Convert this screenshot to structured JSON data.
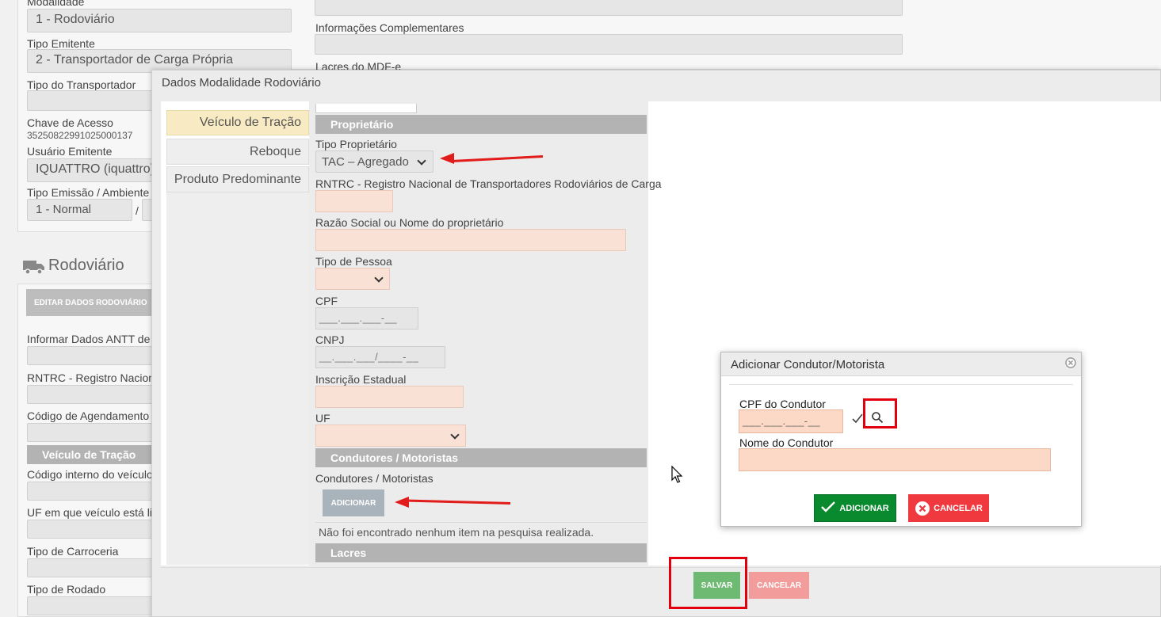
{
  "background": {
    "modalidade_label": "Modalidade",
    "modalidade_value": "1 - Rodoviário",
    "tipo_emitente_label": "Tipo Emitente",
    "tipo_emitente_value": "2 - Transportador de Carga Própria",
    "tipo_transportador_label": "Tipo do Transportador",
    "chave_label": "Chave de Acesso",
    "chave_value": "35250822991025000137",
    "usuario_label": "Usuário Emitente",
    "usuario_value": "IQUATTRO (iquattro)",
    "tipo_emissao_label": "Tipo Emissão / Ambiente",
    "tipo_emissao_value": "1 - Normal",
    "tipo_emissao_sep": "/",
    "info_compl_label": "Informações Complementares",
    "lacres_mdfe_label": "Lacres do MDF-e",
    "rodoviario_title": "Rodoviário",
    "editar_button": "EDITAR DADOS RODOVIÁRIO",
    "informar_antt_label": "Informar Dados ANTT de",
    "rntrc_label": "RNTRC - Registro Naciona",
    "codigo_agendamento_label": "Código de Agendamento n",
    "veiculo_tracao_section": "Veículo de Tração",
    "codigo_interno_label": "Código interno do veículo",
    "uf_licenciado_label": "UF em que veículo está lic",
    "tipo_carroceria_label": "Tipo de Carroceria",
    "tipo_rodado_label": "Tipo de Rodado"
  },
  "modal": {
    "title": "Dados Modalidade Rodoviário",
    "tabs": [
      {
        "label": "Veículo de Tração"
      },
      {
        "label": "Reboque"
      },
      {
        "label": "Produto Predominante"
      }
    ],
    "proprietario_section": "Proprietário",
    "tipo_proprietario_label": "Tipo Proprietário",
    "tipo_proprietario_value": "TAC – Agregado",
    "rntrc_label": "RNTRC - Registro Nacional de Transportadores Rodoviários de Carga",
    "razao_label": "Razão Social ou Nome do proprietário",
    "tipo_pessoa_label": "Tipo de Pessoa",
    "cpf_label": "CPF",
    "cpf_mask": "___.___.___-__",
    "cnpj_label": "CNPJ",
    "cnpj_mask": "__.___.___/____-__",
    "ie_label": "Inscrição Estadual",
    "uf_label": "UF",
    "condutores_section": "Condutores / Motoristas",
    "condutores_label": "Condutores / Motoristas",
    "adicionar_button": "ADICIONAR",
    "empty_message": "Não foi encontrado nenhum item na pesquisa realizada.",
    "lacres_section": "Lacres",
    "salvar_button": "SALVAR",
    "cancelar_button": "CANCELAR"
  },
  "dialog": {
    "title": "Adicionar Condutor/Motorista",
    "cpf_label": "CPF do Condutor",
    "cpf_mask": "___.___.___-__",
    "nome_label": "Nome do Condutor",
    "adicionar_button": "ADICIONAR",
    "cancelar_button": "CANCELAR"
  },
  "colors": {
    "annotation_red": "#e21b1b",
    "tab_active_bg": "#f8eac2",
    "section_gray": "#b3b3b3",
    "green_button": "#0a8a2e",
    "red_button": "#f0383f"
  }
}
